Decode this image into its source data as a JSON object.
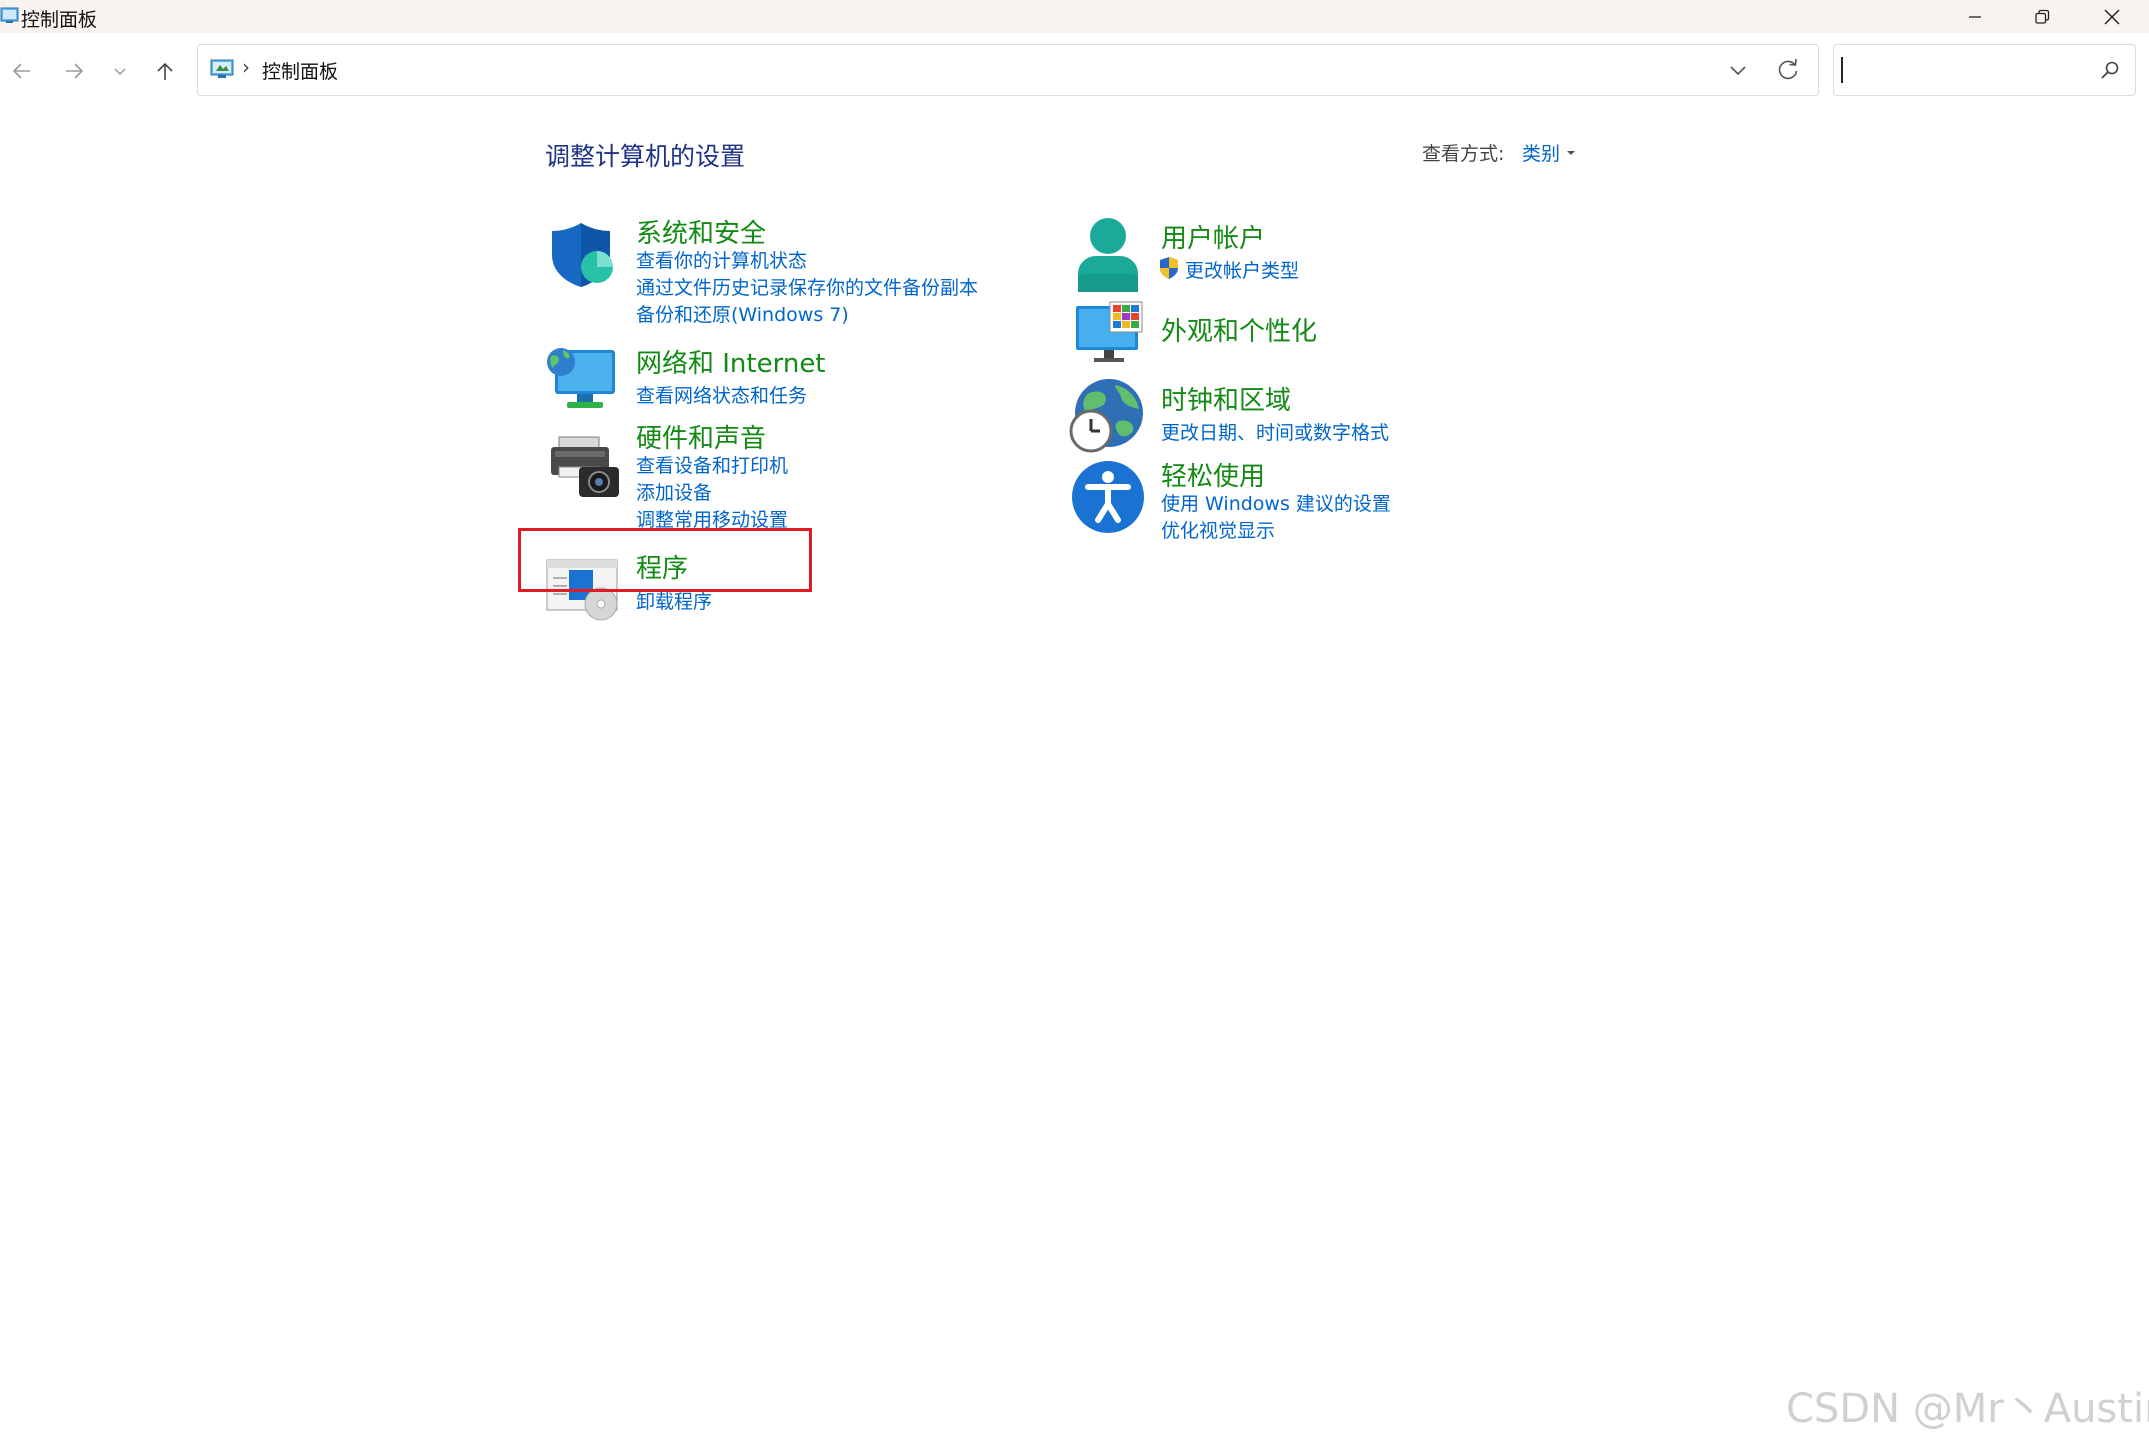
{
  "window": {
    "title": "控制面板",
    "controls": [
      "minimize-icon",
      "restore-icon",
      "close-icon"
    ]
  },
  "navigation": {
    "buttons": [
      "back-arrow-icon",
      "forward-arrow-icon",
      "recent-locations-chevron-icon",
      "up-arrow-icon"
    ],
    "address": {
      "icon": "control-panel-icon",
      "separator": "›",
      "path": "控制面板"
    },
    "search": {
      "value": "",
      "icon": "search-icon"
    }
  },
  "content": {
    "heading": "调整计算机的设置",
    "view_by_label": "查看方式:",
    "view_by_value": "类别",
    "left_column": [
      {
        "icon": "shield-security-icon",
        "title": "系统和安全",
        "links": [
          "查看你的计算机状态",
          "通过文件历史记录保存你的文件备份副本",
          "备份和还原(Windows 7)"
        ]
      },
      {
        "icon": "network-globe-monitor-icon",
        "title": "网络和 Internet",
        "links": [
          "查看网络状态和任务"
        ]
      },
      {
        "icon": "printer-camera-icon",
        "title": "硬件和声音",
        "links": [
          "查看设备和打印机",
          "添加设备",
          "调整常用移动设置"
        ]
      },
      {
        "icon": "programs-disc-icon",
        "title": "程序",
        "links": [
          "卸载程序"
        ],
        "highlighted": true
      }
    ],
    "right_column": [
      {
        "icon": "user-person-icon",
        "title": "用户帐户",
        "links": [
          "更改帐户类型"
        ],
        "link_icon": "uac-shield-icon"
      },
      {
        "icon": "monitor-colors-icon",
        "title": "外观和个性化",
        "links": []
      },
      {
        "icon": "globe-clock-icon",
        "title": "时钟和区域",
        "links": [
          "更改日期、时间或数字格式"
        ]
      },
      {
        "icon": "accessibility-icon",
        "title": "轻松使用",
        "links": [
          "使用 Windows 建议的设置",
          "优化视觉显示"
        ]
      }
    ]
  },
  "highlight_color": "#e01b24",
  "colors": {
    "heading": "#1e3287",
    "category_title": "#138a13",
    "link": "#0066cc"
  },
  "watermark": "CSDN @Mr丶Austin"
}
